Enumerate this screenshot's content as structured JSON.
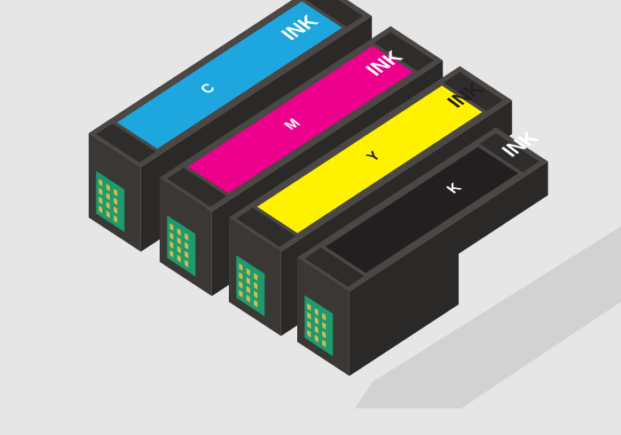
{
  "background_color": "#e6e6e6",
  "cartridges": [
    {
      "letter": "C",
      "label": "INK",
      "label_color": "#1ea7df",
      "text_color": "#ffffff",
      "icon": "cyan-ink-cartridge"
    },
    {
      "letter": "M",
      "label": "INK",
      "label_color": "#ec008c",
      "text_color": "#ffffff",
      "icon": "magenta-ink-cartridge"
    },
    {
      "letter": "Y",
      "label": "INK",
      "label_color": "#fff200",
      "text_color": "#231f20",
      "icon": "yellow-ink-cartridge"
    },
    {
      "letter": "K",
      "label": "INK",
      "label_color": "#231f20",
      "text_color": "#ffffff",
      "icon": "black-ink-cartridge"
    }
  ],
  "colors": {
    "body_top": "#4a4744",
    "body_front": "#3a3735",
    "body_side": "#2b2928",
    "chip": "#1f9a6f",
    "chip_contact": "#d8b84a",
    "shadow": "#d2d2d2"
  }
}
